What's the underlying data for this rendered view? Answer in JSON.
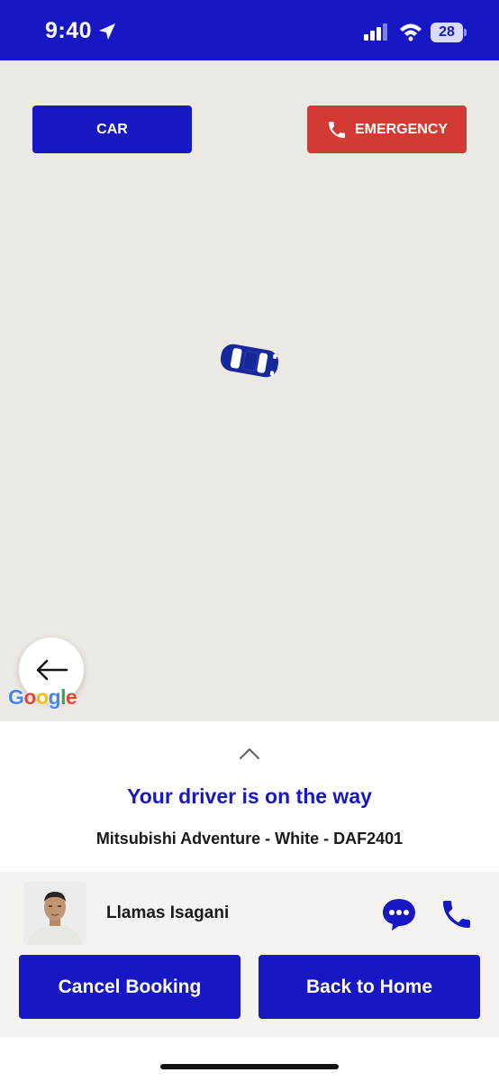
{
  "status_bar": {
    "time": "9:40",
    "battery": "28",
    "background": "#1717c4"
  },
  "map": {
    "car_button_label": "CAR",
    "emergency_button_label": "EMERGENCY",
    "google_logo": "Google",
    "marker_icon": "car-marker-icon",
    "back_icon": "arrow-left-icon"
  },
  "sheet": {
    "title": "Your driver is on the way",
    "vehicle": "Mitsubishi Adventure - White - DAF2401"
  },
  "driver": {
    "name": "Llamas Isagani"
  },
  "actions": {
    "cancel_label": "Cancel Booking",
    "home_label": "Back to Home"
  },
  "colors": {
    "brand": "#1717c4",
    "emergency": "#d23a33",
    "map_bg": "#ece9e5",
    "panel_bg": "#f5f3ef"
  }
}
